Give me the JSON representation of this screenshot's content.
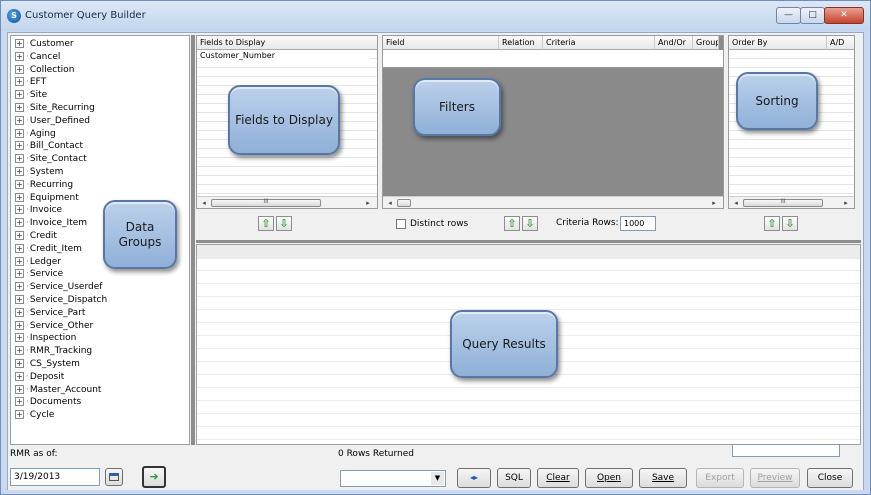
{
  "window": {
    "title": "Customer Query Builder"
  },
  "tree": {
    "items": [
      "Customer",
      "Cancel",
      "Collection",
      "EFT",
      "Site",
      "Site_Recurring",
      "User_Defined",
      "Aging",
      "Bill_Contact",
      "Site_Contact",
      "System",
      "Recurring",
      "Equipment",
      "Invoice",
      "Invoice_Item",
      "Credit",
      "Credit_Item",
      "Ledger",
      "Service",
      "Service_Userdef",
      "Service_Dispatch",
      "Service_Part",
      "Service_Other",
      "Inspection",
      "RMR_Tracking",
      "CS_System",
      "Deposit",
      "Master_Account",
      "Documents",
      "Cycle"
    ]
  },
  "fields_panel": {
    "header": "Fields to Display",
    "rows": [
      "Customer_Number"
    ]
  },
  "filters_panel": {
    "columns": [
      "Field",
      "Relation",
      "Criteria",
      "And/Or",
      "Group"
    ],
    "distinct_label": "Distinct rows",
    "criteria_rows_label": "Criteria Rows:",
    "criteria_rows_value": "1000"
  },
  "sorting_panel": {
    "columns": [
      "Order By",
      "A/D"
    ]
  },
  "callouts": {
    "data_groups": "Data Groups",
    "fields": "Fields to Display",
    "filters": "Filters",
    "sorting": "Sorting",
    "results": "Query Results"
  },
  "bottom": {
    "rmr_label": "RMR as of:",
    "rmr_date": "3/19/2013",
    "rows_returned": "0 Rows Returned",
    "buttons": {
      "sql": "SQL",
      "clear": "Clear",
      "open": "Open",
      "save": "Save",
      "export": "Export",
      "preview": "Preview",
      "close": "Close"
    }
  },
  "icons": {
    "scroll_dots": "III",
    "up_arrow": "⇧",
    "down_arrow": "⇩",
    "go_arrow": "➜",
    "swap_arrows": "◂▸",
    "dropdown_arrow": "▼",
    "minimize": "—",
    "maximize": "□",
    "close": "✕"
  }
}
